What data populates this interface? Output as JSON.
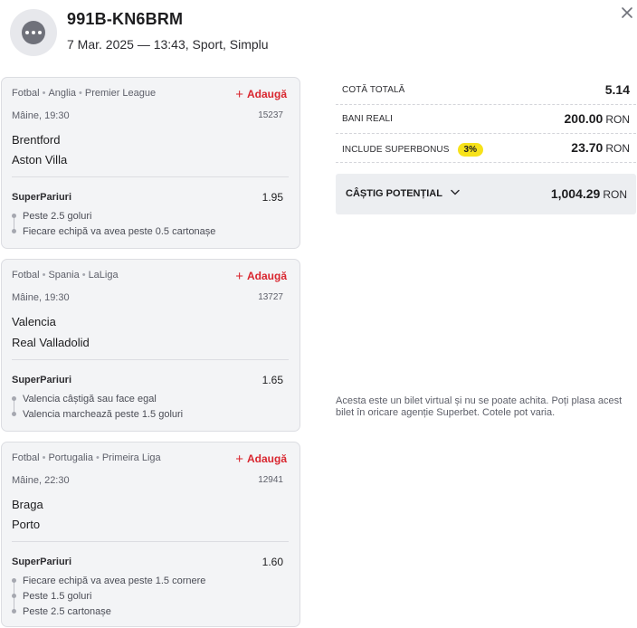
{
  "header": {
    "ticket_id": "991B-KN6BRM",
    "meta": "7 Mar. 2025 — 13:43, Sport, Simplu",
    "avatar_icon": "more-dots-icon",
    "close_icon": "close-icon"
  },
  "common": {
    "add_label": "Adaugă",
    "superpariuri_label": "SuperPariuri"
  },
  "events": [
    {
      "sport": "Fotbal",
      "country": "Anglia",
      "league": "Premier League",
      "time": "Mâine, 19:30",
      "code": "15237",
      "home": "Brentford",
      "away": "Aston Villa",
      "odds": "1.95",
      "selections": [
        "Peste 2.5 goluri",
        "Fiecare echipă va avea peste 0.5 cartonașe"
      ]
    },
    {
      "sport": "Fotbal",
      "country": "Spania",
      "league": "LaLiga",
      "time": "Mâine, 19:30",
      "code": "13727",
      "home": "Valencia",
      "away": "Real Valladolid",
      "odds": "1.65",
      "selections": [
        "Valencia câștigă sau face egal",
        "Valencia marchează peste 1.5 goluri"
      ]
    },
    {
      "sport": "Fotbal",
      "country": "Portugalia",
      "league": "Primeira Liga",
      "time": "Mâine, 22:30",
      "code": "12941",
      "home": "Braga",
      "away": "Porto",
      "odds": "1.60",
      "selections": [
        "Fiecare echipă va avea peste 1.5 cornere",
        "Peste 1.5 goluri",
        "Peste 2.5 cartonașe"
      ]
    }
  ],
  "summary": {
    "total_odds_label": "COTĂ TOTALĂ",
    "total_odds": "5.14",
    "real_money_label": "BANI REALI",
    "real_money": "200.00",
    "superbonus_label": "INCLUDE SUPERBONUS",
    "superbonus_badge": "3%",
    "superbonus_value": "23.70",
    "currency": "RON",
    "potential_label": "CÂȘTIG POTENȚIAL",
    "potential_value": "1,004.29"
  },
  "disclaimer": "Acesta este un bilet virtual și nu se poate achita. Poți plasa acest bilet în oricare agenție Superbet. Cotele pot varia.",
  "colors": {
    "accent_red": "#d9262f",
    "badge_yellow": "#f7e21a",
    "card_bg": "#f3f4f6"
  }
}
